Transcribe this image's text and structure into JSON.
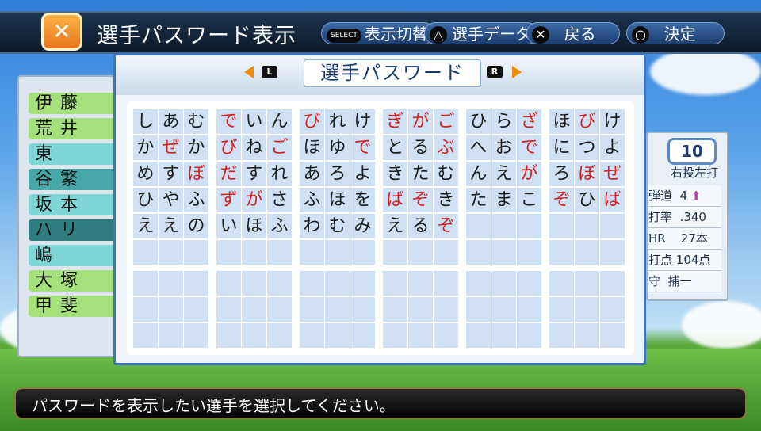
{
  "header": {
    "title": "選手パスワード表示",
    "logo_icon": "crossed-bats-icon",
    "controls": [
      {
        "key": "SELECT",
        "label": "表示切替"
      },
      {
        "key": "△",
        "label": "選手データ"
      },
      {
        "key": "✕",
        "label": "戻る"
      },
      {
        "key": "○",
        "label": "決定"
      }
    ]
  },
  "player_list": [
    "伊藤",
    "荒井",
    "東",
    "谷繁",
    "坂本",
    "ハリ",
    "嶋",
    "大塚",
    "甲斐"
  ],
  "player_stats": {
    "number": "10",
    "hand": "右投左打",
    "rows": [
      {
        "label": "弾道",
        "value": "4"
      },
      {
        "label": "打率",
        "value": ".340"
      },
      {
        "label": "HR",
        "value": "27本"
      },
      {
        "label": "打点",
        "value": "104点"
      },
      {
        "label": "守",
        "value": "捕一"
      }
    ]
  },
  "dialog": {
    "title": "選手パスワード",
    "left_shoulder": "L",
    "right_shoulder": "R"
  },
  "password_grid": {
    "rows": [
      [
        "し",
        "あ",
        "む",
        "で",
        "い",
        "ん",
        "び",
        "れ",
        "け",
        "ぎ",
        "が",
        "ご",
        "ひ",
        "ら",
        "ざ",
        "ほ",
        "び",
        "け"
      ],
      [
        "か",
        "ぜ",
        "か",
        "び",
        "ね",
        "ご",
        "ほ",
        "ゆ",
        "で",
        "と",
        "る",
        "ぶ",
        "へ",
        "お",
        "で",
        "に",
        "つ",
        "よ"
      ],
      [
        "め",
        "す",
        "ぼ",
        "だ",
        "す",
        "れ",
        "あ",
        "ろ",
        "よ",
        "き",
        "た",
        "む",
        "ん",
        "え",
        "が",
        "ろ",
        "ぼ",
        "ぜ"
      ],
      [
        "ひ",
        "や",
        "ふ",
        "ず",
        "が",
        "さ",
        "ふ",
        "ほ",
        "を",
        "ば",
        "ぞ",
        "き",
        "た",
        "ま",
        "こ",
        "ぞ",
        "ひ",
        "ば"
      ],
      [
        "え",
        "え",
        "の",
        "い",
        "ほ",
        "ふ",
        "わ",
        "む",
        "み",
        "え",
        "る",
        "ぞ",
        "",
        "",
        "",
        "",
        "",
        ""
      ],
      [
        "",
        "",
        "",
        "",
        "",
        "",
        "",
        "",
        "",
        "",
        "",
        "",
        "",
        "",
        "",
        "",
        "",
        ""
      ],
      [
        "",
        "",
        "",
        "",
        "",
        "",
        "",
        "",
        "",
        "",
        "",
        "",
        "",
        "",
        "",
        "",
        "",
        ""
      ],
      [
        "",
        "",
        "",
        "",
        "",
        "",
        "",
        "",
        "",
        "",
        "",
        "",
        "",
        "",
        "",
        "",
        "",
        ""
      ],
      [
        "",
        "",
        "",
        "",
        "",
        "",
        "",
        "",
        "",
        "",
        "",
        "",
        "",
        "",
        "",
        "",
        "",
        ""
      ]
    ],
    "red_chars": [
      "で",
      "び",
      "ぎ",
      "が",
      "ご",
      "ざ",
      "ぜ",
      "ぼ",
      "だ",
      "ぶ",
      "ず",
      "ば",
      "ぞ"
    ]
  },
  "message": "パスワードを表示したい選手を選択してください。"
}
